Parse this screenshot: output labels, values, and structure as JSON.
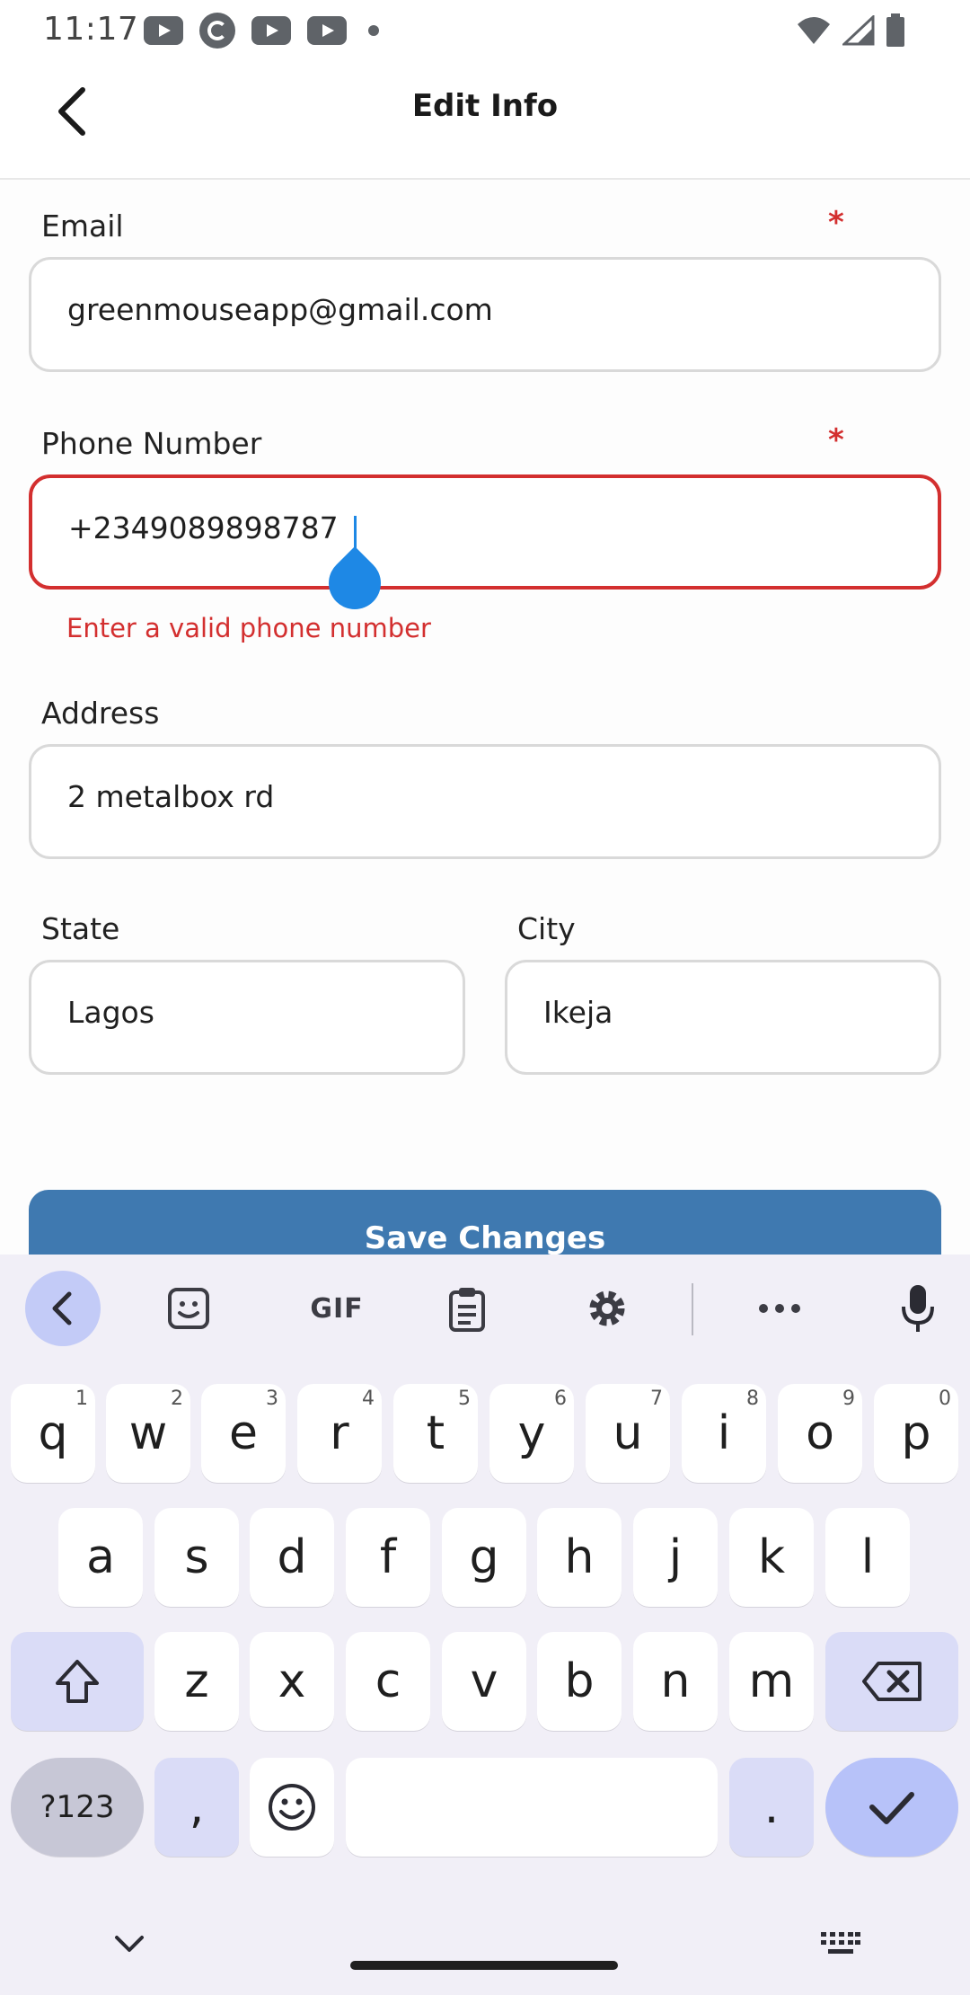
{
  "status_bar": {
    "time": "11:17",
    "left_icons": [
      "youtube-icon",
      "sync-icon",
      "youtube-icon",
      "youtube-icon",
      "dot-icon"
    ],
    "right_icons": [
      "wifi-icon",
      "signal-icon",
      "battery-icon"
    ]
  },
  "header": {
    "title": "Edit Info",
    "back_icon": "chevron-left-icon"
  },
  "form": {
    "email": {
      "label": "Email",
      "required_mark": "*",
      "value": "greenmouseapp@gmail.com"
    },
    "phone": {
      "label": "Phone Number",
      "required_mark": "*",
      "value": "+2349089898787",
      "error": "Enter a valid phone number"
    },
    "address": {
      "label": "Address",
      "value": "2 metalbox rd"
    },
    "state": {
      "label": "State",
      "value": "Lagos"
    },
    "city": {
      "label": "City",
      "value": "Ikeja"
    },
    "save_label": "Save Changes"
  },
  "colors": {
    "error": "#d32f2f",
    "button": "#3f79b0",
    "caret": "#1e88e5",
    "keyboard_bg": "#f1eff7"
  },
  "keyboard": {
    "toolbar": {
      "gif_label": "GIF",
      "icons": [
        "chevron-left-icon",
        "sticker-icon",
        "gif-icon",
        "clipboard-icon",
        "settings-icon",
        "more-icon",
        "microphone-icon"
      ]
    },
    "row1": [
      {
        "k": "q",
        "h": "1"
      },
      {
        "k": "w",
        "h": "2"
      },
      {
        "k": "e",
        "h": "3"
      },
      {
        "k": "r",
        "h": "4"
      },
      {
        "k": "t",
        "h": "5"
      },
      {
        "k": "y",
        "h": "6"
      },
      {
        "k": "u",
        "h": "7"
      },
      {
        "k": "i",
        "h": "8"
      },
      {
        "k": "o",
        "h": "9"
      },
      {
        "k": "p",
        "h": "0"
      }
    ],
    "row2": [
      "a",
      "s",
      "d",
      "f",
      "g",
      "h",
      "j",
      "k",
      "l"
    ],
    "row3": [
      "z",
      "x",
      "c",
      "v",
      "b",
      "n",
      "m"
    ],
    "sym_label": "?123",
    "comma": ",",
    "period": ".",
    "nav": {
      "collapse_icon": "chevron-down-icon",
      "keyboard_switch_icon": "keyboard-icon"
    }
  }
}
